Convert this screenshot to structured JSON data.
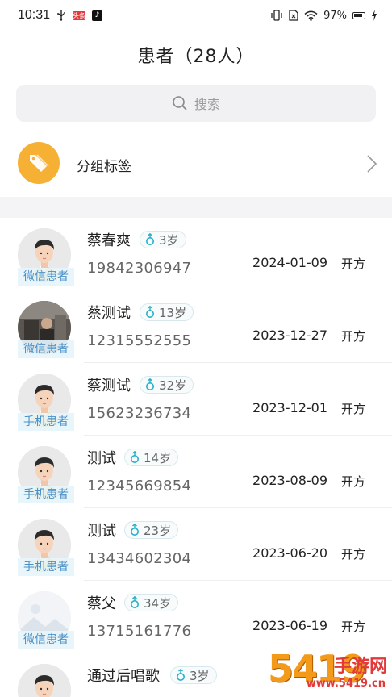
{
  "status_bar": {
    "time": "10:31",
    "battery": "97%",
    "app_badge_red": "头条",
    "app_badge_dark": "♪"
  },
  "header": {
    "title": "患者（28人）"
  },
  "search": {
    "placeholder": "搜索"
  },
  "group": {
    "label": "分组标签"
  },
  "patients": [
    {
      "name": "蔡春爽",
      "age": "3岁",
      "phone": "19842306947",
      "date": "2024-01-09",
      "action": "开方",
      "tag": "微信患者",
      "avatar": "default-male"
    },
    {
      "name": "蔡测试",
      "age": "13岁",
      "phone": "12315552555",
      "date": "2023-12-27",
      "action": "开方",
      "tag": "微信患者",
      "avatar": "photo"
    },
    {
      "name": "蔡测试",
      "age": "32岁",
      "phone": "15623236734",
      "date": "2023-12-01",
      "action": "开方",
      "tag": "手机患者",
      "avatar": "default-male"
    },
    {
      "name": "测试",
      "age": "14岁",
      "phone": "12345669854",
      "date": "2023-08-09",
      "action": "开方",
      "tag": "手机患者",
      "avatar": "default-male"
    },
    {
      "name": "测试",
      "age": "23岁",
      "phone": "13434602304",
      "date": "2023-06-20",
      "action": "开方",
      "tag": "手机患者",
      "avatar": "default-male"
    },
    {
      "name": "蔡父",
      "age": "34岁",
      "phone": "13715161776",
      "date": "2023-06-19",
      "action": "开方",
      "tag": "微信患者",
      "avatar": "placeholder-image"
    },
    {
      "name": "通过后唱歌",
      "age": "3岁",
      "phone": "",
      "date": "",
      "action": "",
      "tag": "",
      "avatar": "default-male"
    }
  ],
  "watermark": {
    "logo": "5419",
    "text": "手游网",
    "domain": "www.5419.cn"
  },
  "colors": {
    "accent_orange": "#f6b134",
    "tag_blue": "#4a90c8",
    "watermark_red": "#e23a3a"
  }
}
